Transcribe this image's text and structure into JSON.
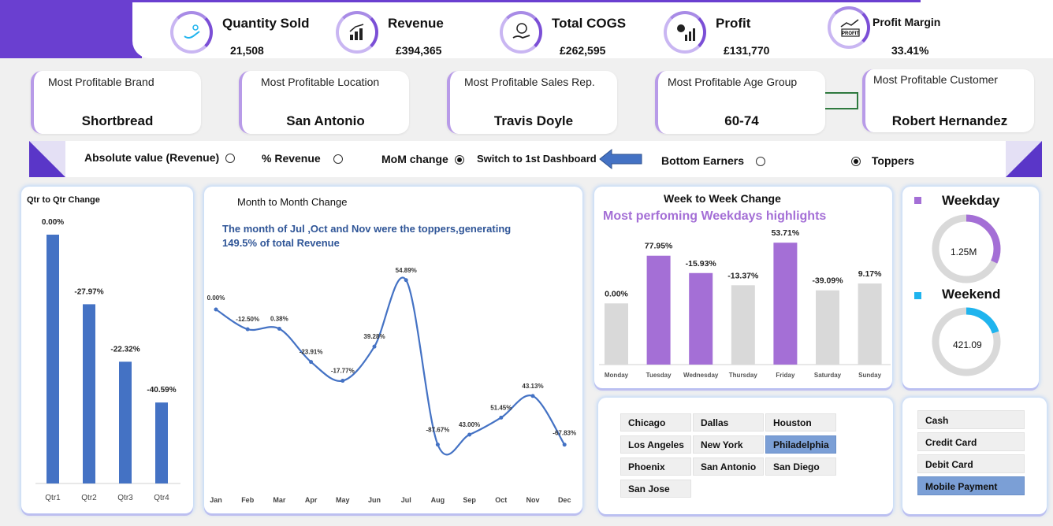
{
  "kpis": [
    {
      "label": "Quantity Sold",
      "value": "21,508",
      "icon": "hand-plant-icon"
    },
    {
      "label": "Revenue",
      "value": "£394,365",
      "icon": "revenue-chart-icon"
    },
    {
      "label": "Total COGS",
      "value": "£262,595",
      "icon": "coin-hand-icon"
    },
    {
      "label": "Profit",
      "value": "£131,770",
      "icon": "profit-growth-icon"
    },
    {
      "label": "Profit Margin",
      "value": "33.41%",
      "icon": "profit-board-icon",
      "icon_text": "PROFIT"
    }
  ],
  "most_profitable": [
    {
      "title": "Most Profitable Brand",
      "value": "Shortbread"
    },
    {
      "title": "Most Profitable Location",
      "value": "San Antonio"
    },
    {
      "title": "Most Profitable Sales Rep.",
      "value": "Travis Doyle"
    },
    {
      "title": "Most Profitable Age Group",
      "value": "60-74"
    },
    {
      "title": "Most Profitable Customer",
      "value": "Robert Hernandez"
    }
  ],
  "options": {
    "absolute": "Absolute value (Revenue)",
    "percent": "% Revenue",
    "mom": "MoM change",
    "switch": "Switch to 1st Dashboard",
    "bottom": "Bottom Earners",
    "toppers": "Toppers"
  },
  "colors": {
    "accent": "#6a3fd0",
    "bar_blue": "#4472c4",
    "purple_bar": "#a46fd6",
    "grey_bar": "#d9d9d9",
    "cyan": "#1fb4ee"
  },
  "qtr_title": "Qtr to Qtr Change",
  "mom_title": "Month to Month Change",
  "mom_note": "The month of Jul ,Oct and Nov were the toppers,generating 149.5% of total Revenue",
  "wow_title": "Week to Week Change",
  "wow_subtitle": "Most perfoming Weekdays highlights",
  "chart_data": [
    {
      "type": "bar",
      "title": "Qtr to Qtr Change",
      "categories": [
        "Qtr1",
        "Qtr2",
        "Qtr3",
        "Qtr4"
      ],
      "values": [
        0.0,
        -27.97,
        -22.32,
        -40.59
      ],
      "labels": [
        "0.00%",
        "-27.97%",
        "-22.32%",
        "-40.59%"
      ],
      "bar_heights": [
        100,
        72.03,
        48.93,
        32.54
      ]
    },
    {
      "type": "line",
      "title": "Month to Month Change",
      "categories": [
        "Jan",
        "Feb",
        "Mar",
        "Apr",
        "May",
        "Jun",
        "Jul",
        "Aug",
        "Sep",
        "Oct",
        "Nov",
        "Dec"
      ],
      "values": [
        0.0,
        -12.5,
        0.38,
        -23.91,
        -17.77,
        39.28,
        54.89,
        -87.67,
        43.0,
        51.45,
        43.13,
        -67.83
      ],
      "labels": [
        "0.00%",
        "-12.50%",
        "0.38%",
        "-23.91%",
        "-17.77%",
        "39.28%",
        "54.89%",
        "-87.67%",
        "43.00%",
        "51.45%",
        "43.13%",
        "-67.83%"
      ],
      "line_levels": [
        100,
        87.5,
        87.83,
        66.83,
        54.95,
        76.53,
        118.53,
        14.62,
        20.91,
        31.67,
        45.32,
        14.58
      ]
    },
    {
      "type": "bar",
      "title": "Week to Week Change",
      "categories": [
        "Monday",
        "Tuesday",
        "Wednesday",
        "Thursday",
        "Friday",
        "Saturday",
        "Sunday"
      ],
      "values": [
        0.0,
        77.95,
        -15.93,
        -13.37,
        53.71,
        -39.09,
        9.17
      ],
      "labels": [
        "0.00%",
        "77.95%",
        "-15.93%",
        "-13.37%",
        "53.71%",
        "-39.09%",
        "9.17%"
      ],
      "highlight": [
        false,
        true,
        true,
        false,
        true,
        false,
        false
      ],
      "bar_heights": [
        100,
        177.95,
        149.6,
        129.6,
        199.22,
        121.36,
        132.5
      ]
    },
    {
      "type": "pie",
      "title": "Weekday",
      "center_label": "1.25M",
      "fraction": 0.32
    },
    {
      "type": "pie",
      "title": "Weekend",
      "center_label": "421.09",
      "fraction": 0.2
    }
  ],
  "cities": [
    {
      "name": "Chicago",
      "selected": false
    },
    {
      "name": "Dallas",
      "selected": false
    },
    {
      "name": "Houston",
      "selected": false
    },
    {
      "name": "Los Angeles",
      "selected": false
    },
    {
      "name": "New York",
      "selected": false
    },
    {
      "name": "Philadelphia",
      "selected": true
    },
    {
      "name": "Phoenix",
      "selected": false
    },
    {
      "name": "San Antonio",
      "selected": false
    },
    {
      "name": "San Diego",
      "selected": false
    },
    {
      "name": "San Jose",
      "selected": false
    }
  ],
  "payments": [
    {
      "name": "Cash",
      "selected": false
    },
    {
      "name": "Credit Card",
      "selected": false
    },
    {
      "name": "Debit Card",
      "selected": false
    },
    {
      "name": "Mobile Payment",
      "selected": true
    }
  ]
}
